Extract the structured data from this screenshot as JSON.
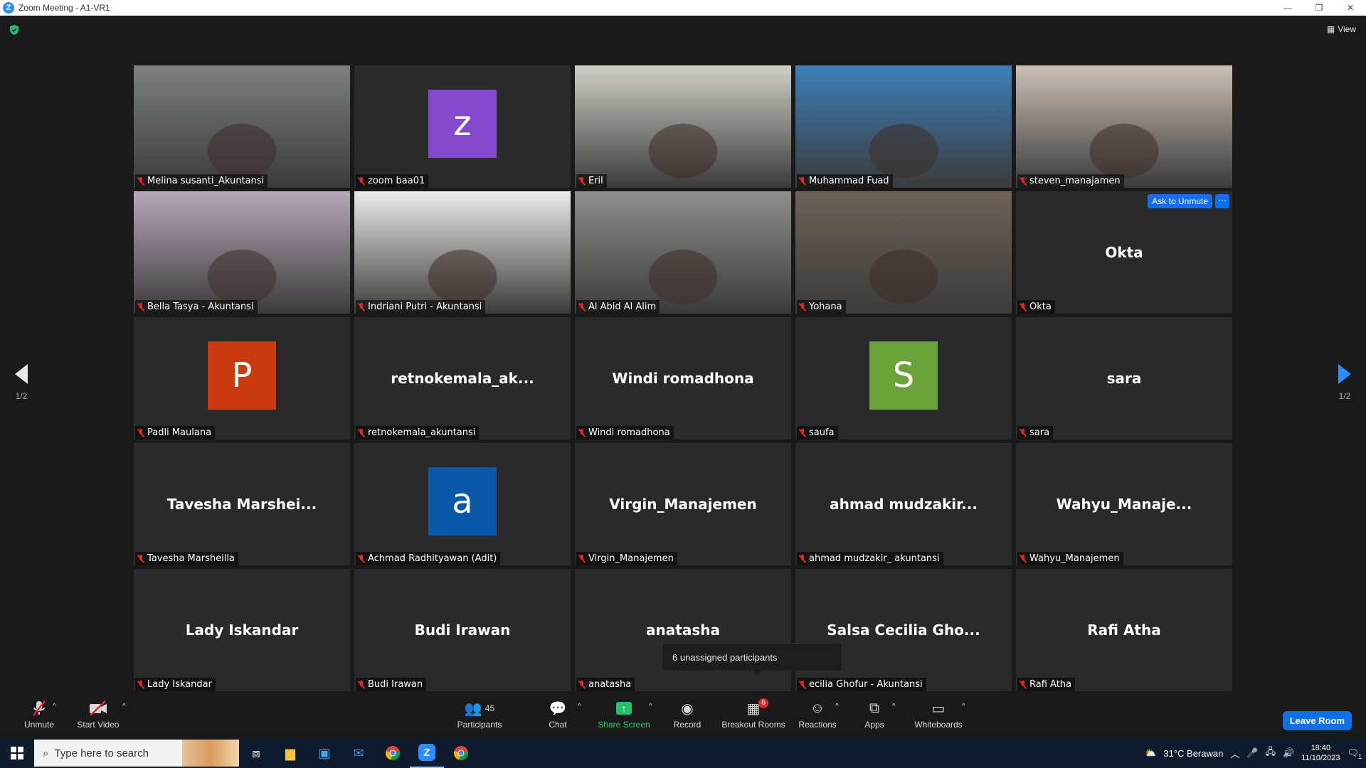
{
  "window": {
    "title": "Zoom Meeting - A1-VR1",
    "minimize": "—",
    "restore": "❐",
    "close": "✕"
  },
  "header": {
    "view_label": "View"
  },
  "tiles": [
    {
      "name": "Melina susanti_Akuntansi",
      "kind": "video",
      "bg": "#7d7f80"
    },
    {
      "name": "zoom baa01",
      "kind": "avatar",
      "letter": "z",
      "avatar_color": "#8348cc"
    },
    {
      "name": "Eril",
      "kind": "video",
      "bg": "#cfcfc7"
    },
    {
      "name": "Muhammad Fuad",
      "kind": "video",
      "bg": "#3d7fb8",
      "active": true
    },
    {
      "name": "steven_manajamen",
      "kind": "video",
      "bg": "#cbbfb5"
    },
    {
      "name": "Bella Tasya - Akuntansi",
      "kind": "video",
      "bg": "#b7a8b8"
    },
    {
      "name": "Indriani Putri - Akuntansi",
      "kind": "video",
      "bg": "#ecebe7"
    },
    {
      "name": "Al Abid Al Alim",
      "kind": "video",
      "bg": "#8e8e8a"
    },
    {
      "name": "Yohana",
      "kind": "video",
      "bg": "#6e6258"
    },
    {
      "name": "Okta",
      "kind": "name",
      "display": "Okta",
      "hover": true
    },
    {
      "name": "Padli Maulana",
      "kind": "avatar",
      "letter": "P",
      "avatar_color": "#cc3a10"
    },
    {
      "name": "retnokemala_akuntansi",
      "kind": "name",
      "display": "retnokemala_ak..."
    },
    {
      "name": "Windi romadhona",
      "kind": "name",
      "display": "Windi romadhona"
    },
    {
      "name": "saufa",
      "kind": "avatar",
      "letter": "S",
      "avatar_color": "#6ba33a"
    },
    {
      "name": "sara",
      "kind": "name",
      "display": "sara"
    },
    {
      "name": "Tavesha Marsheilla",
      "kind": "name",
      "display": "Tavesha Marshei..."
    },
    {
      "name": "Achmad Radhityawan (Adit)",
      "kind": "avatar",
      "letter": "a",
      "avatar_color": "#0b57a8"
    },
    {
      "name": "Virgin_Manajemen",
      "kind": "name",
      "display": "Virgin_Manajemen"
    },
    {
      "name": "ahmad mudzakir_ akuntansi",
      "kind": "name",
      "display": "ahmad mudzakir..."
    },
    {
      "name": "Wahyu_Manajemen",
      "kind": "name",
      "display": "Wahyu_Manaje..."
    },
    {
      "name": "Lady Iskandar",
      "kind": "name",
      "display": "Lady Iskandar"
    },
    {
      "name": "Budi Irawan",
      "kind": "name",
      "display": "Budi Irawan"
    },
    {
      "name": "anatasha",
      "kind": "name",
      "display": "anatasha"
    },
    {
      "name": "ecilia Ghofur - Akuntansi",
      "kind": "name",
      "display": "Salsa Cecilia Gho..."
    },
    {
      "name": "Rafi Atha",
      "kind": "name",
      "display": "Rafi Atha"
    }
  ],
  "hover_actions": {
    "ask_unmute": "Ask to Unmute",
    "more": "···"
  },
  "pager": {
    "left": "1/2",
    "right": "1/2"
  },
  "tooltip": "6 unassigned participants",
  "toolbar": {
    "unmute": "Unmute",
    "start_video": "Start Video",
    "participants": "Participants",
    "participants_count": "45",
    "chat": "Chat",
    "share_screen": "Share Screen",
    "record": "Record",
    "breakout_rooms": "Breakout Rooms",
    "breakout_badge": "6",
    "reactions": "Reactions",
    "apps": "Apps",
    "whiteboards": "Whiteboards",
    "leave": "Leave Room"
  },
  "taskbar": {
    "search_placeholder": "Type here to search",
    "weather": "31°C  Berawan",
    "time": "18:40",
    "date": "11/10/2023",
    "notif_count": "1"
  }
}
